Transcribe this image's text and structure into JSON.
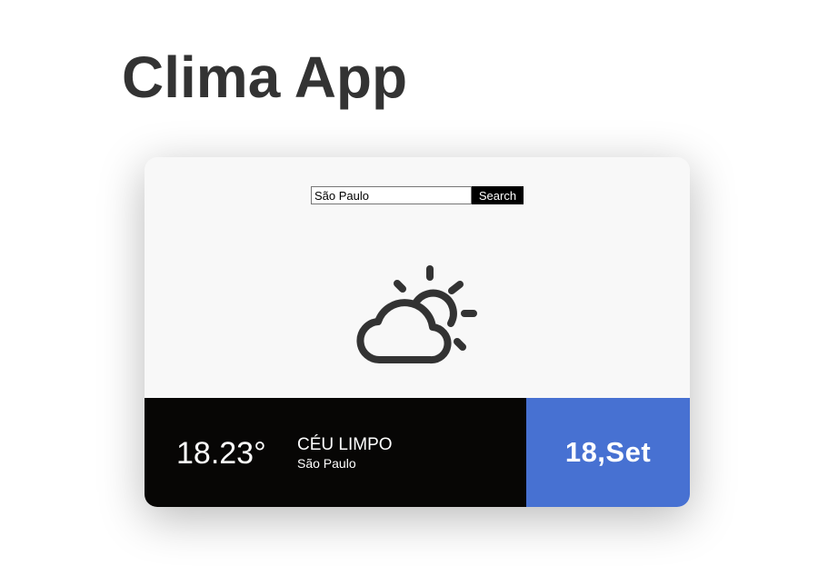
{
  "app_title": "Clima App",
  "search": {
    "value": "São Paulo",
    "button_label": "Search"
  },
  "weather": {
    "icon": "partly-cloudy-icon",
    "temperature": "18.23°",
    "description": "CÉU LIMPO",
    "city": "São Paulo",
    "date": "18,Set"
  },
  "colors": {
    "title": "#333333",
    "card_background": "#f8f8f8",
    "info_bar": "#070605",
    "date_box": "#4771d2",
    "icon_stroke": "#333333"
  }
}
